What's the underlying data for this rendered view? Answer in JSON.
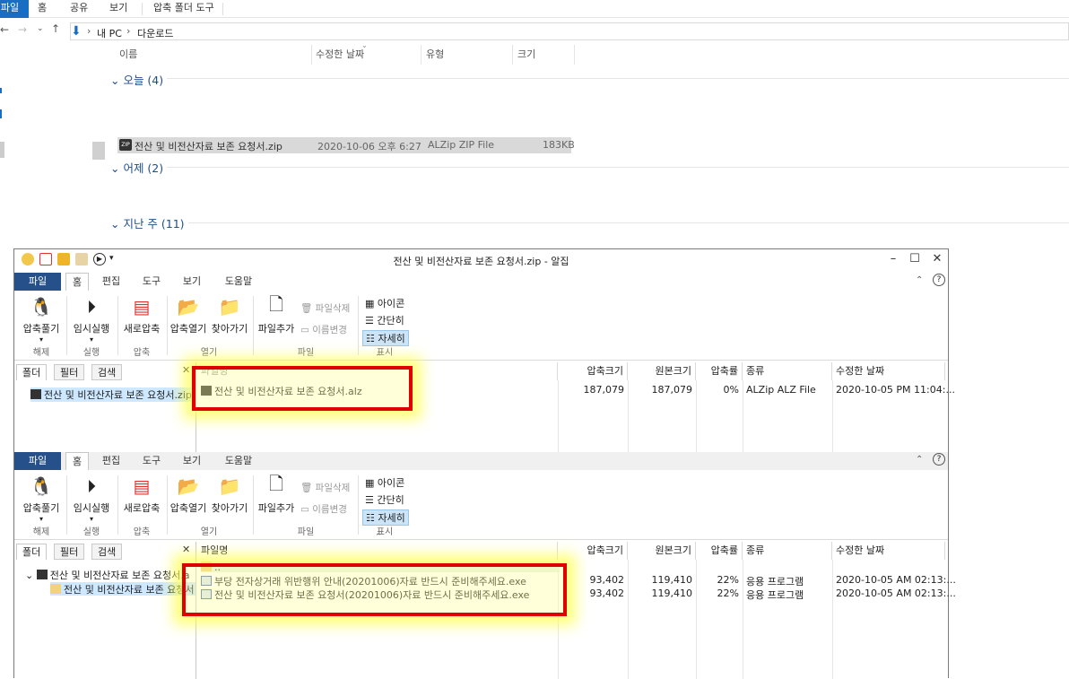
{
  "explorer": {
    "tabs": [
      "파일",
      "홈",
      "공유",
      "보기",
      "압축 폴더 도구"
    ],
    "breadcrumb": [
      "내 PC",
      "다운로드"
    ],
    "columns": [
      "이름",
      "수정한 날짜",
      "유형",
      "크기"
    ],
    "groups": {
      "today": "오늘 (4)",
      "yesterday": "어제 (2)",
      "lastweek": "지난 주 (11)"
    },
    "row": {
      "name": "전산 및 비전산자료 보존 요청서.zip",
      "date": "2020-10-06 오후 6:27",
      "type": "ALZip ZIP File",
      "size": "183KB"
    }
  },
  "alzip": {
    "title": "전산 및 비전산자료 보존 요청서.zip - 알집",
    "tabs": [
      "파일",
      "홈",
      "편집",
      "도구",
      "보기",
      "도움말"
    ],
    "ribbon": {
      "extract": "압축풀기",
      "extract_group": "해제",
      "run": "임시실행",
      "run_group": "실행",
      "newzip": "새로압축",
      "zip_group": "압축",
      "openzip": "압축열기",
      "find": "찾아가기",
      "open_group": "열기",
      "addfile": "파일추가",
      "delfile": "파일삭제",
      "rename": "이름변경",
      "file_group": "파일",
      "view_icon": "아이콘",
      "view_simple": "간단히",
      "view_detail": "자세히",
      "view_group": "표시"
    },
    "left_tabs": [
      "폴더",
      "필터",
      "검색"
    ],
    "list_headers": [
      "파일명",
      "압축크기",
      "원본크기",
      "압축률",
      "종류",
      "수정한 날짜"
    ],
    "pane1": {
      "tree": "전산 및 비전산자료 보존 요청서.zip",
      "rows": [
        {
          "name": "전산 및 비전산자료 보존 요청서.alz",
          "packed": "187,079",
          "orig": "187,079",
          "ratio": "0%",
          "kind": "ALZip ALZ File",
          "date": "2020-10-05 PM 11:04:..."
        }
      ]
    },
    "pane2": {
      "tree": [
        "전산 및 비전산자료 보존 요청서.a",
        "전산 및 비전산자료 보존 요청서"
      ],
      "parent": "..",
      "rows": [
        {
          "name": "부당 전자상거래 위반행위 안내(20201006)자료 반드시 준비해주세요.exe",
          "packed": "93,402",
          "orig": "119,410",
          "ratio": "22%",
          "kind": "응용 프로그램",
          "date": "2020-10-05 AM 02:13:..."
        },
        {
          "name": "전산 및 비전산자료 보존 요청서(20201006)자료 반드시 준비해주세요.exe",
          "packed": "93,402",
          "orig": "119,410",
          "ratio": "22%",
          "kind": "응용 프로그램",
          "date": "2020-10-05 AM 02:13:..."
        }
      ]
    }
  }
}
